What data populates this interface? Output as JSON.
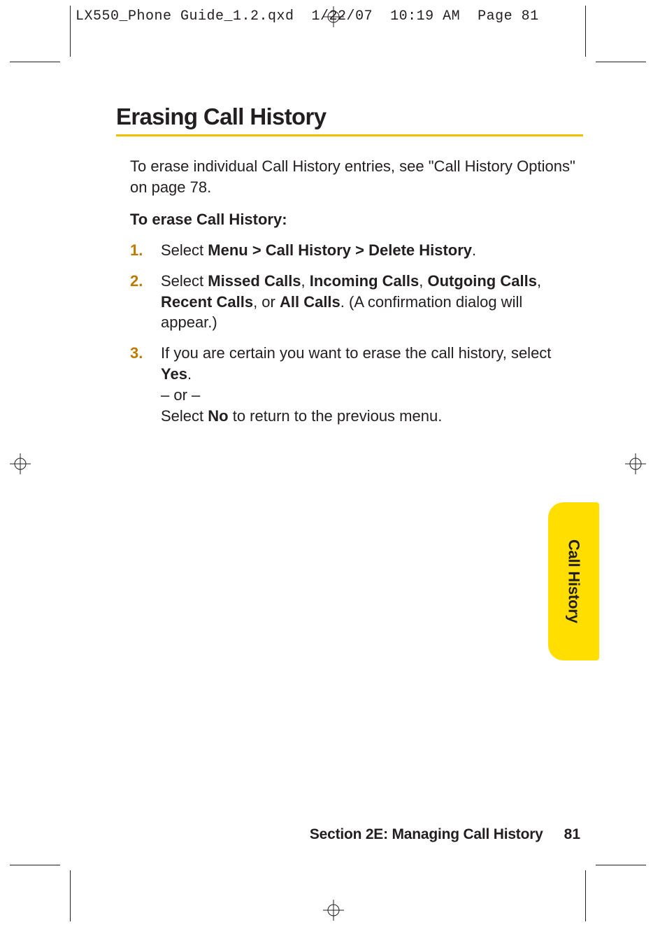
{
  "slug": "LX550_Phone Guide_1.2.qxd  1/22/07  10:19 AM  Page 81",
  "title": "Erasing Call History",
  "intro": "To erase individual Call History entries, see \"Call History Options\" on page 78.",
  "subtitle": "To erase Call History:",
  "steps": {
    "s1": {
      "num": "1.",
      "pre": "Select ",
      "bold": "Menu > Call History > Delete History",
      "post": "."
    },
    "s2": {
      "num": "2.",
      "pre": "Select ",
      "b1": "Missed Calls",
      "c1": ", ",
      "b2": "Incoming Calls",
      "c2": ", ",
      "b3": "Outgoing Calls",
      "c3": ", ",
      "b4": "Recent Calls",
      "c4": ", or ",
      "b5": "All Calls",
      "post": ". (A confirmation dialog will appear.)"
    },
    "s3": {
      "num": "3.",
      "l1a": "If you are certain you want to erase the call history, select ",
      "l1b": "Yes",
      "l1c": ".",
      "or": "– or –",
      "l2a": "Select ",
      "l2b": "No",
      "l2c": " to return to the previous menu."
    }
  },
  "side_tab": "Call History",
  "footer": {
    "section": "Section 2E: Managing Call History",
    "page": "81"
  }
}
